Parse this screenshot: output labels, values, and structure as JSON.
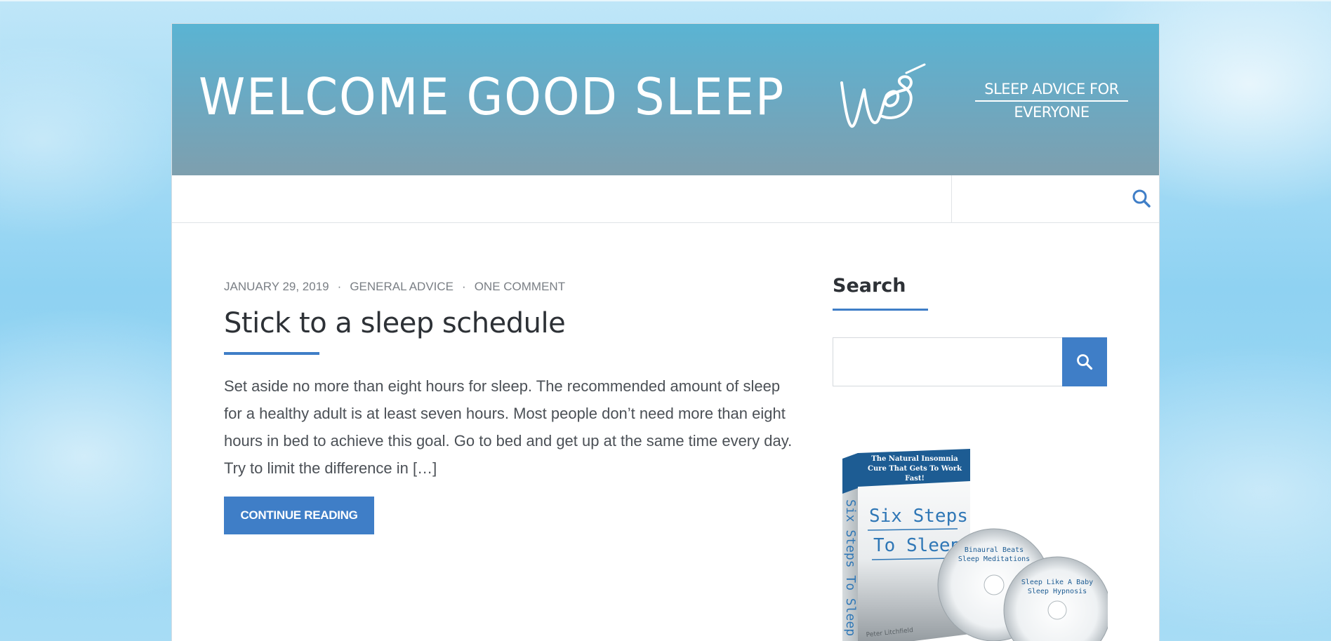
{
  "colors": {
    "accent": "#3f7ec7",
    "banner_top": "#5ab4d3",
    "banner_bottom": "#7e9fae",
    "text_dark": "#2d3136",
    "text_meta": "#7a7f85",
    "background_sky": "#8fd2f2"
  },
  "banner": {
    "title": "WELCOME GOOD SLEEP",
    "logo_text": "wgs",
    "tagline_line1": "SLEEP ADVICE FOR",
    "tagline_line2": "EVERYONE"
  },
  "nav": {
    "search_icon": "search-icon"
  },
  "post": {
    "date": "JANUARY 29, 2019",
    "category": "GENERAL ADVICE",
    "comments": "ONE COMMENT",
    "separator": "·",
    "title": "Stick to a sleep schedule",
    "excerpt": "Set aside no more than eight hours for sleep. The recommended amount of sleep for a healthy adult is at least seven hours. Most people don’t need more than eight hours in bed to achieve this goal. Go to bed and get up at the same time every day. Try to limit the difference in […]",
    "continue_label": "CONTINUE READING"
  },
  "sidebar": {
    "search_widget_title": "Search",
    "search_value": "",
    "search_button_icon": "search-icon",
    "product": {
      "box_banner": "The Natural Insomnia Cure That Gets To Work Fast!",
      "box_title_line1": "Six Steps",
      "box_title_line2": "To Sleep",
      "box_spine": "Six Steps To Sleep",
      "box_author": "Peter Litchfield",
      "disc1_title": "Binaural Beats Sleep Meditations",
      "disc2_title": "Sleep Like A Baby Sleep Hypnosis"
    }
  }
}
